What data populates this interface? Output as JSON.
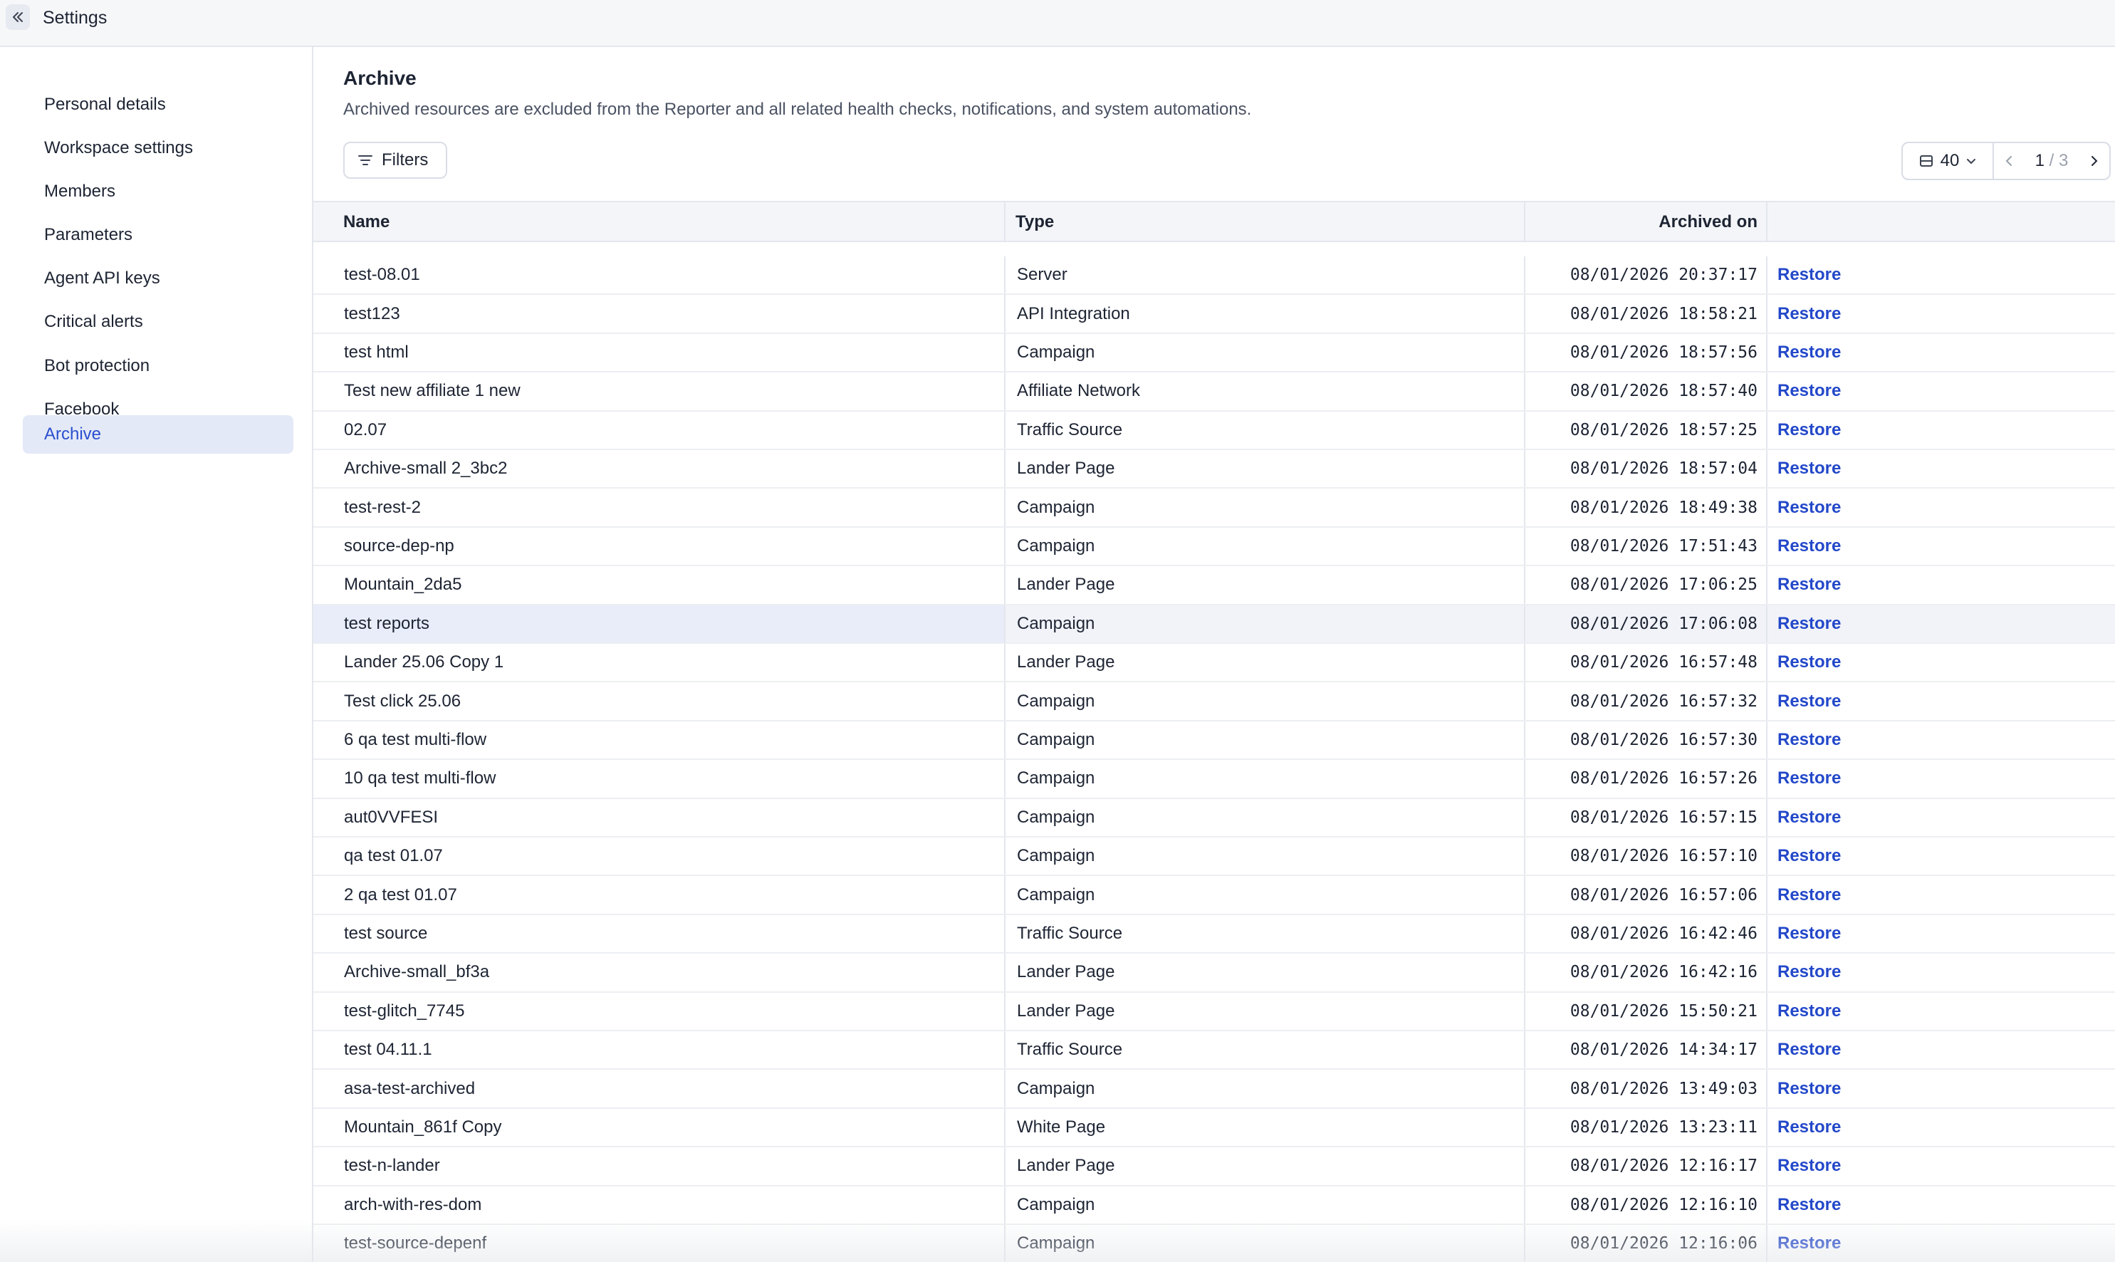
{
  "header": {
    "title": "Settings"
  },
  "sidebar": {
    "items": [
      {
        "label": "Personal details",
        "active": false
      },
      {
        "label": "Workspace settings",
        "active": false
      },
      {
        "label": "Members",
        "active": false
      },
      {
        "label": "Parameters",
        "active": false
      },
      {
        "label": "Agent API keys",
        "active": false
      },
      {
        "label": "Critical alerts",
        "active": false
      },
      {
        "label": "Bot protection",
        "active": false
      },
      {
        "label": "Facebook",
        "active": false
      },
      {
        "label": "Archive",
        "active": true
      }
    ]
  },
  "main": {
    "title": "Archive",
    "description": "Archived resources are excluded from the Reporter and all related health checks, notifications, and system automations.",
    "filters_label": "Filters",
    "per_page": "40",
    "pagination": {
      "current": "1",
      "separator": "/",
      "total": "3"
    },
    "columns": {
      "name": "Name",
      "type": "Type",
      "archived_on": "Archived on"
    },
    "action_label": "Restore",
    "rows": [
      {
        "name": "test-08.01",
        "type": "Server",
        "archived_on": "08/01/2026 20:37:17"
      },
      {
        "name": "test123",
        "type": "API Integration",
        "archived_on": "08/01/2026 18:58:21"
      },
      {
        "name": "test html",
        "type": "Campaign",
        "archived_on": "08/01/2026 18:57:56"
      },
      {
        "name": "Test new affiliate 1 new",
        "type": "Affiliate Network",
        "archived_on": "08/01/2026 18:57:40"
      },
      {
        "name": "02.07",
        "type": "Traffic Source",
        "archived_on": "08/01/2026 18:57:25"
      },
      {
        "name": "Archive-small 2_3bc2",
        "type": "Lander Page",
        "archived_on": "08/01/2026 18:57:04"
      },
      {
        "name": "test-rest-2",
        "type": "Campaign",
        "archived_on": "08/01/2026 18:49:38"
      },
      {
        "name": "source-dep-np",
        "type": "Campaign",
        "archived_on": "08/01/2026 17:51:43"
      },
      {
        "name": "Mountain_2da5",
        "type": "Lander Page",
        "archived_on": "08/01/2026 17:06:25"
      },
      {
        "name": "test reports",
        "type": "Campaign",
        "archived_on": "08/01/2026 17:06:08",
        "highlighted": true
      },
      {
        "name": "Lander 25.06 Copy 1",
        "type": "Lander Page",
        "archived_on": "08/01/2026 16:57:48"
      },
      {
        "name": "Test click 25.06",
        "type": "Campaign",
        "archived_on": "08/01/2026 16:57:32"
      },
      {
        "name": "6 qa test multi-flow",
        "type": "Campaign",
        "archived_on": "08/01/2026 16:57:30"
      },
      {
        "name": "10 qa test multi-flow",
        "type": "Campaign",
        "archived_on": "08/01/2026 16:57:26"
      },
      {
        "name": "aut0VVFESI",
        "type": "Campaign",
        "archived_on": "08/01/2026 16:57:15"
      },
      {
        "name": "qa test 01.07",
        "type": "Campaign",
        "archived_on": "08/01/2026 16:57:10"
      },
      {
        "name": "2 qa test 01.07",
        "type": "Campaign",
        "archived_on": "08/01/2026 16:57:06"
      },
      {
        "name": "test source",
        "type": "Traffic Source",
        "archived_on": "08/01/2026 16:42:46"
      },
      {
        "name": "Archive-small_bf3a",
        "type": "Lander Page",
        "archived_on": "08/01/2026 16:42:16"
      },
      {
        "name": "test-glitch_7745",
        "type": "Lander Page",
        "archived_on": "08/01/2026 15:50:21"
      },
      {
        "name": "test 04.11.1",
        "type": "Traffic Source",
        "archived_on": "08/01/2026 14:34:17"
      },
      {
        "name": "asa-test-archived",
        "type": "Campaign",
        "archived_on": "08/01/2026 13:49:03"
      },
      {
        "name": "Mountain_861f Copy",
        "type": "White Page",
        "archived_on": "08/01/2026 13:23:11"
      },
      {
        "name": "test-n-lander",
        "type": "Lander Page",
        "archived_on": "08/01/2026 12:16:17"
      },
      {
        "name": "arch-with-res-dom",
        "type": "Campaign",
        "archived_on": "08/01/2026 12:16:10"
      },
      {
        "name": "test-source-depenf",
        "type": "Campaign",
        "archived_on": "08/01/2026 12:16:06"
      }
    ]
  },
  "colors": {
    "accent": "#2348c9",
    "active_nav_bg": "#e4e9f7",
    "row_highlight": "#e9edfa"
  },
  "icons": {
    "collapse": "double-chevron-left-icon",
    "filter": "filter-lines-icon",
    "rows": "rows-icon",
    "chevron_down": "chevron-down-icon",
    "prev": "chevron-left-icon",
    "next": "chevron-right-icon"
  }
}
